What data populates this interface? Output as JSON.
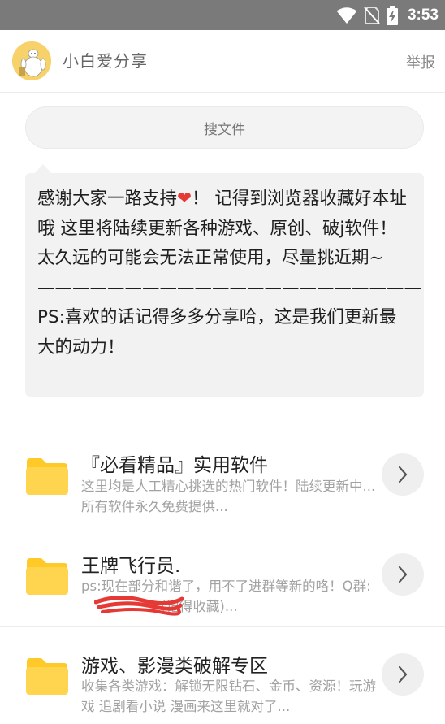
{
  "status_bar": {
    "time": "3:53",
    "icons": [
      "wifi-icon",
      "no-sim-icon",
      "battery-charging-icon"
    ],
    "background": "#7a7a7a"
  },
  "header": {
    "shop_name": "小白爱分享",
    "report_label": "举报"
  },
  "search": {
    "label": "搜文件"
  },
  "notice": {
    "text_before_heart": "感谢大家一路支持",
    "heart": "❤",
    "text_after_heart": "！ 记得到浏览器收藏好本址哦 这里将陆续更新各种游戏、原创、破j软件！太久远的可能会无法正常使用，尽量挑近期~\n——————————————————————\nPS:喜欢的话记得多多分享哈，这是我们更新最大的动力！"
  },
  "folders": [
    {
      "title": "『必看精品』实用软件",
      "description": "这里均是人工精心挑选的热门软件！陆续更新中...所有软件永久免费提供..."
    },
    {
      "title": "王牌飞行员.",
      "description": "ps:现在部分和谐了，用不了进群等新的咯！Q群:",
      "description_tail": "(记得收藏)..."
    },
    {
      "title": "游戏、影漫类破解专区",
      "description": "收集各类游戏：解锁无限钻石、金币、资源！玩游戏 追剧看小说 漫画来这里就对了..."
    }
  ],
  "colors": {
    "folder": "#ffd54f",
    "folder_tab": "#ffca28",
    "redaction": "#e53935"
  }
}
